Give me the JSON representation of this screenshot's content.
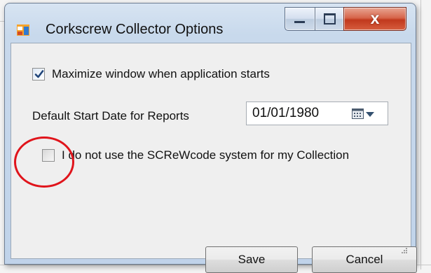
{
  "window": {
    "title": "Corkscrew Collector Options",
    "close_glyph": "x",
    "icons": [
      "app-window-icon",
      "minimize-icon",
      "maximize-icon",
      "close-icon"
    ]
  },
  "options": {
    "maximize": {
      "label": "Maximize window when application starts",
      "checked": true
    },
    "start_date": {
      "label": "Default Start Date for Reports",
      "value": "01/01/1980"
    },
    "screwcode": {
      "label": "I do not use the SCReWcode system for my Collection",
      "checked": false
    }
  },
  "buttons": {
    "save": "Save",
    "cancel": "Cancel"
  },
  "colors": {
    "annotation_circle": "#e0141b",
    "title_bar": "#c8d9ec",
    "close_button": "#c1391d"
  }
}
